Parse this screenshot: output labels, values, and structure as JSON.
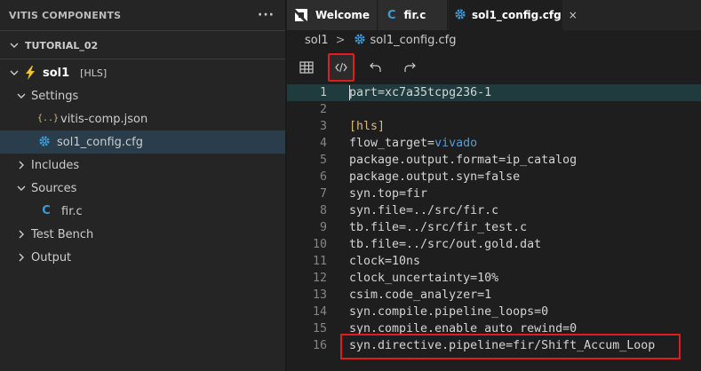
{
  "sidebar": {
    "title": "VITIS COMPONENTS",
    "more_label": "···",
    "project": "TUTORIAL_02",
    "component": {
      "name": "sol1",
      "tag": "[HLS]"
    },
    "settings_label": "Settings",
    "settings_files": [
      "vitis-comp.json",
      "sol1_config.cfg"
    ],
    "includes_label": "Includes",
    "sources_label": "Sources",
    "source_files": [
      "fir.c"
    ],
    "testbench_label": "Test Bench",
    "output_label": "Output",
    "json_icon_text": "{..}",
    "c_icon_text": "C"
  },
  "tabs": [
    {
      "label": "Welcome"
    },
    {
      "label": "fir.c",
      "icon_text": "C"
    },
    {
      "label": "sol1_config.cfg",
      "close": "×"
    }
  ],
  "breadcrumb": {
    "root": "sol1",
    "sep": ">",
    "file": "sol1_config.cfg"
  },
  "editor": {
    "lines": [
      "part=xc7a35tcpg236-1",
      "",
      "[hls]",
      "flow_target=vivado",
      "package.output.format=ip_catalog",
      "package.output.syn=false",
      "syn.top=fir",
      "syn.file=../src/fir.c",
      "tb.file=../src/fir_test.c",
      "tb.file=../src/out.gold.dat",
      "clock=10ns",
      "clock_uncertainty=10%",
      "csim.code_analyzer=1",
      "syn.compile.pipeline_loops=0",
      "syn.compile.enable_auto_rewind=0",
      "syn.directive.pipeline=fir/Shift_Accum_Loop"
    ],
    "line_numbers": [
      "1",
      "2",
      "3",
      "4",
      "5",
      "6",
      "7",
      "8",
      "9",
      "10",
      "11",
      "12",
      "13",
      "14",
      "15",
      "16"
    ]
  },
  "colors": {
    "accent_red": "#e21b1b",
    "c_blue": "#3c9cd7",
    "gear_blue": "#3c9cd7",
    "json_yellow": "#d7ba7d",
    "bolt_yellow": "#f1c232"
  }
}
